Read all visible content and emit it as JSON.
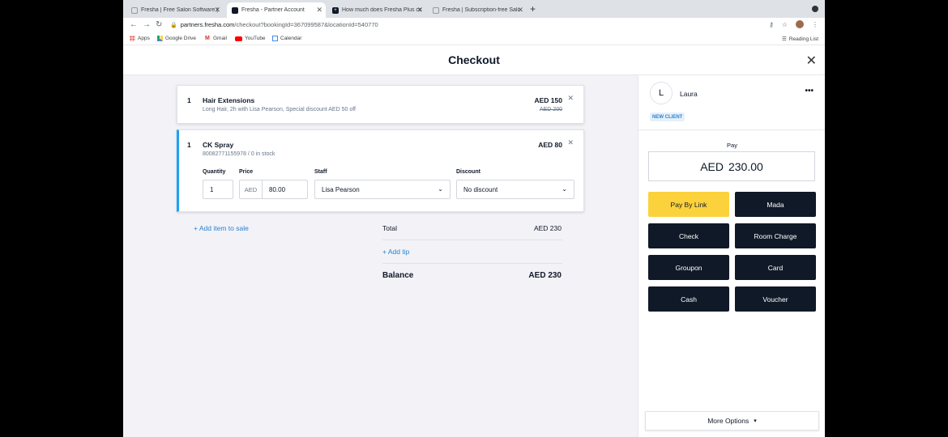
{
  "browser": {
    "tabs": [
      {
        "title": "Fresha | Free Salon Software |",
        "active": false
      },
      {
        "title": "Fresha - Partner Account",
        "active": true
      },
      {
        "title": "How much does Fresha Plus co",
        "active": false
      },
      {
        "title": "Fresha | Subscription-free Salo",
        "active": false
      }
    ],
    "url_host": "partners.fresha.com",
    "url_path": "/checkout?bookingId=367099587&locationId=540770",
    "bookmarks": [
      "Apps",
      "Google Drive",
      "Gmail",
      "YouTube",
      "Calendar"
    ],
    "reading_list": "Reading List"
  },
  "header": {
    "title": "Checkout"
  },
  "items": [
    {
      "qty": "1",
      "name": "Hair Extensions",
      "desc": "Long Hair, 2h with Lisa Pearson, Special discount AED 50 off",
      "price": "AED 150",
      "old_price": "AED 200"
    },
    {
      "qty": "1",
      "name": "CK Spray",
      "desc": "80082771155978 / 0 in stock",
      "price": "AED 80",
      "labels": {
        "quantity": "Quantity",
        "price": "Price",
        "staff": "Staff",
        "discount": "Discount"
      },
      "quantity_value": "1",
      "price_prefix": "AED",
      "price_value": "80.00",
      "staff_value": "Lisa Pearson",
      "discount_value": "No discount"
    }
  ],
  "add_item": "+ Add item to sale",
  "totals": {
    "total_label": "Total",
    "total_value": "AED 230",
    "add_tip": "+ Add tip",
    "balance_label": "Balance",
    "balance_value": "AED 230"
  },
  "client": {
    "initial": "L",
    "name": "Laura",
    "menu": "•••",
    "badge": "NEW CLIENT"
  },
  "payment": {
    "label": "Pay",
    "currency": "AED",
    "amount": "230.00",
    "methods": [
      "Pay By Link",
      "Mada",
      "Check",
      "Room Charge",
      "Groupon",
      "Card",
      "Cash",
      "Voucher"
    ],
    "more_options": "More Options"
  },
  "colors": {
    "accent_blue": "#2883d3",
    "dark": "#101928",
    "yellow": "#fcd23c"
  }
}
